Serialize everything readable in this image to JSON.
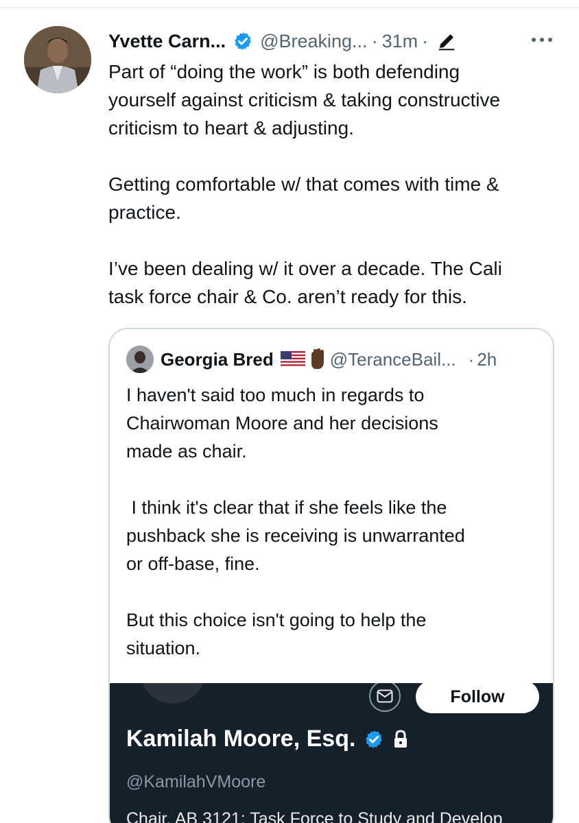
{
  "tweet": {
    "author_name": "Yvette Carn...",
    "handle": "@Breaking...",
    "separator": "·",
    "time": "31m",
    "paragraphs": [
      [
        "Part of “doing the work” is both defending",
        "yourself against criticism & taking constructive",
        "criticism to heart & adjusting."
      ],
      [
        "Getting comfortable w/ that comes with time &",
        "practice."
      ],
      [
        "I’ve been dealing w/ it over a decade. The Cali",
        "task force chair & Co. aren’t ready for this."
      ]
    ],
    "icons": {
      "verified": "verified-badge-icon",
      "edit": "edit-pencil-icon",
      "more": "more-options-icon"
    }
  },
  "quote": {
    "author_name": "Georgia Bred",
    "handle": "@TeranceBail...",
    "separator": "·",
    "time": "2h",
    "paragraphs": [
      [
        "I haven't said too much in regards to",
        "Chairwoman Moore and her decisions",
        "made as chair."
      ],
      [
        " I think it's clear that if she feels like the",
        "pushback she is receiving is unwarranted",
        "or off-base, fine."
      ],
      [
        "But this choice isn't going to help the",
        "situation."
      ]
    ],
    "icons": {
      "flag": "us-flag-icon",
      "fist": "raised-fist-icon"
    }
  },
  "embedded_profile": {
    "name": "Kamilah Moore, Esq.",
    "handle": "@KamilahVMoore",
    "bio": "Chair, AB 3121: Task Force to Study and Develop",
    "follow_label": "Follow",
    "icons": {
      "message": "message-envelope-icon",
      "verified": "verified-badge-icon",
      "lock": "lock-icon"
    }
  },
  "colors": {
    "text": "#0f1419",
    "secondary": "#536471",
    "verified_blue": "#1d9bf0",
    "border": "#cfd9de",
    "dark_bg": "#15202b"
  }
}
